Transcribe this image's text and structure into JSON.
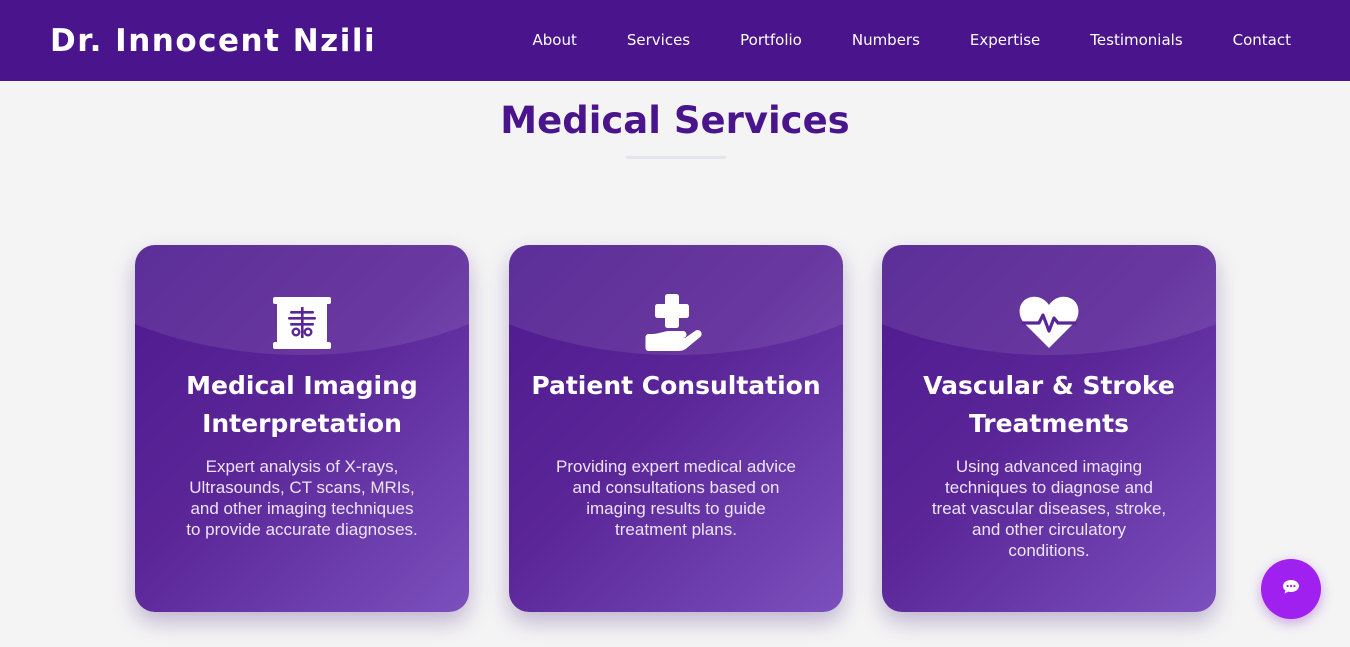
{
  "header": {
    "brand": "Dr. Innocent Nzili",
    "nav": [
      "About",
      "Services",
      "Portfolio",
      "Numbers",
      "Expertise",
      "Testimonials",
      "Contact"
    ]
  },
  "section": {
    "title": "Medical Services"
  },
  "cards": [
    {
      "icon": "x-ray-icon",
      "title": "Medical Imaging Interpretation",
      "description": "Expert analysis of X-rays, Ultrasounds, CT scans, MRIs, and other imaging techniques to provide accurate diagnoses."
    },
    {
      "icon": "hand-holding-medical-icon",
      "title": "Patient Consultation",
      "description": "Providing expert medical advice and consultations based on imaging results to guide treatment plans."
    },
    {
      "icon": "heart-pulse-icon",
      "title": "Vascular & Stroke Treatments",
      "description": "Using advanced imaging techniques to diagnose and treat vascular diseases, stroke, and other circulatory conditions."
    }
  ],
  "chat": {
    "icon": "chat-bubble-icon"
  },
  "colors": {
    "header_bg": "#4a148c",
    "title": "#4a148c",
    "card_gradient_start": "#4d1a8e",
    "card_gradient_end": "#7b50bd",
    "chat_button": "#a020f0",
    "page_bg": "#f4f4f5"
  }
}
